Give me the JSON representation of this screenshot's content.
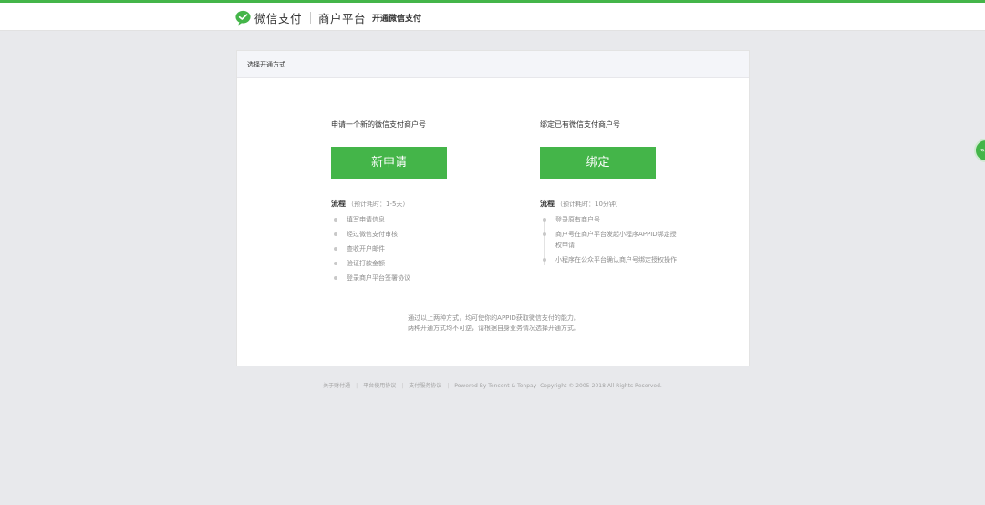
{
  "header": {
    "brand_name": "微信支付",
    "platform": "商户平台",
    "subtitle": "开通微信支付"
  },
  "card": {
    "title": "选择开通方式",
    "left": {
      "title": "申请一个新的微信支付商户号",
      "button": "新申请",
      "process_label": "流程",
      "process_time": "（预计耗时：1-5天）",
      "steps": [
        "填写申请信息",
        "经过微信支付审核",
        "查收开户邮件",
        "验证打款金额",
        "登录商户平台签署协议"
      ]
    },
    "right": {
      "title": "绑定已有微信支付商户号",
      "button": "绑定",
      "process_label": "流程",
      "process_time": "（预计耗时：10分钟）",
      "steps": [
        "登录原有商户号",
        "商户号在商户平台发起小程序APPID绑定授权申请",
        "小程序在公众平台确认商户号绑定授权操作"
      ]
    },
    "note_line1": "通过以上两种方式，均可使你的APPID获取微信支付的能力。",
    "note_line2": "两种开通方式均不可逆，请根据自身业务情况选择开通方式。"
  },
  "footer": {
    "links": [
      "关于财付通",
      "平台使用协议",
      "支付服务协议"
    ],
    "powered": "Powered By Tencent & Tenpay",
    "copyright": "Copyright © 2005-2018 All Rights Reserved."
  },
  "float_button": {
    "icon": "chat-icon"
  },
  "colors": {
    "accent": "#44b549",
    "background": "#e8e9ec"
  }
}
